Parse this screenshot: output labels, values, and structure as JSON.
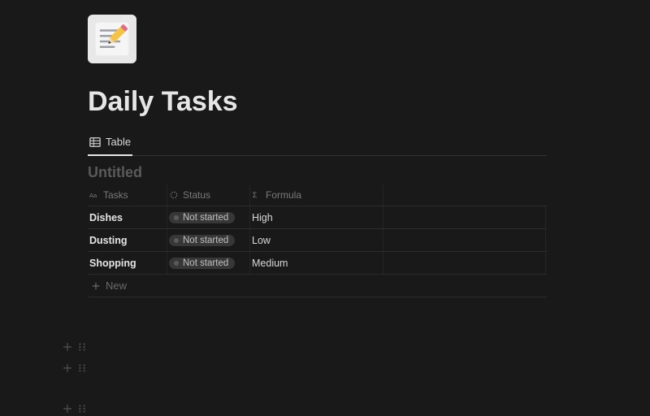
{
  "page": {
    "title": "Daily Tasks"
  },
  "tabs": {
    "active": "Table"
  },
  "database": {
    "title": "Untitled"
  },
  "columns": {
    "tasks": "Tasks",
    "status": "Status",
    "formula": "Formula"
  },
  "rows": [
    {
      "task": "Dishes",
      "status": "Not started",
      "formula": "High"
    },
    {
      "task": "Dusting",
      "status": "Not started",
      "formula": "Low"
    },
    {
      "task": "Shopping",
      "status": "Not started",
      "formula": "Medium"
    }
  ],
  "newRow": "New"
}
